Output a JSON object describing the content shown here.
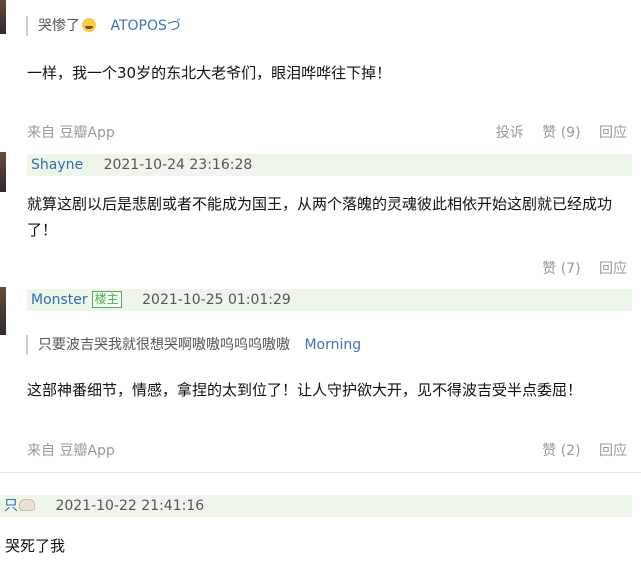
{
  "reply1": {
    "quote_text": "哭惨了",
    "quote_author": "ATOPOSづ",
    "body": "一样，我一个30岁的东北大老爷们，眼泪哗哗往下掉！",
    "source": "来自 豆瓣App",
    "report": "投诉",
    "like": "赞 (9)",
    "reply": "回应"
  },
  "comment2": {
    "user": "Shayne",
    "time": "2021-10-24 23:16:28",
    "body": "就算这剧以后是悲剧或者不能成为国王，从两个落魄的灵魂彼此相依开始这剧就已经成功了！",
    "like": "赞 (7)",
    "reply": "回应"
  },
  "comment3": {
    "user": "Monster",
    "badge": "楼主",
    "time": "2021-10-25 01:01:29",
    "quote_text": "只要波吉哭我就很想哭啊嗷嗷呜呜呜嗷嗷",
    "quote_author": "Morning",
    "body": "这部神番细节，情感，拿捏的太到位了！让人守护欲大开，见不得波吉受半点委屈！",
    "source": "来自 豆瓣App",
    "like": "赞 (2)",
    "reply": "回应"
  },
  "comment4": {
    "user": "只",
    "time": "2021-10-22 21:41:16",
    "body": "哭死了我"
  },
  "colors": {
    "link": "#3f73b6",
    "meta_bg": "#eef6ec",
    "muted": "#9a9a9a",
    "badge": "#4caf50"
  }
}
